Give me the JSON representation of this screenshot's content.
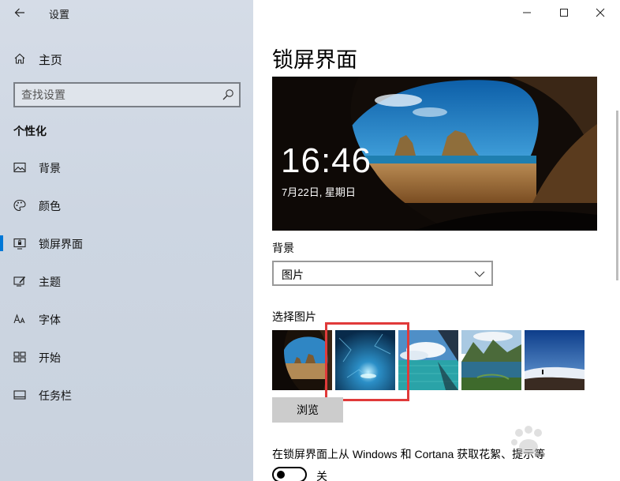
{
  "app": {
    "title": "设置"
  },
  "sidebar": {
    "home_label": "主页",
    "search_placeholder": "查找设置",
    "section_title": "个性化",
    "items": [
      {
        "label": "背景",
        "icon": "image-icon",
        "selected": false
      },
      {
        "label": "颜色",
        "icon": "palette-icon",
        "selected": false
      },
      {
        "label": "锁屏界面",
        "icon": "lock-screen-icon",
        "selected": true
      },
      {
        "label": "主题",
        "icon": "theme-icon",
        "selected": false
      },
      {
        "label": "字体",
        "icon": "font-icon",
        "selected": false
      },
      {
        "label": "开始",
        "icon": "start-icon",
        "selected": false
      },
      {
        "label": "任务栏",
        "icon": "taskbar-icon",
        "selected": false
      }
    ]
  },
  "main": {
    "page_title": "锁屏界面",
    "preview": {
      "time": "16:46",
      "date": "7月22日, 星期日"
    },
    "background_label": "背景",
    "background_value": "图片",
    "choose_picture_label": "选择图片",
    "thumbnails": [
      {
        "name": "cave-beach",
        "selected": false
      },
      {
        "name": "ice-cave",
        "selected": true
      },
      {
        "name": "sea-sky",
        "selected": false
      },
      {
        "name": "mountain-lake",
        "selected": false
      },
      {
        "name": "cloud-sea",
        "selected": false
      }
    ],
    "browse_label": "浏览",
    "fun_facts_label": "在锁屏界面上从 Windows 和 Cortana 获取花絮、提示等",
    "toggle_state": "关"
  },
  "colors": {
    "accent": "#0078d7",
    "highlight_box": "#e03a3a"
  }
}
